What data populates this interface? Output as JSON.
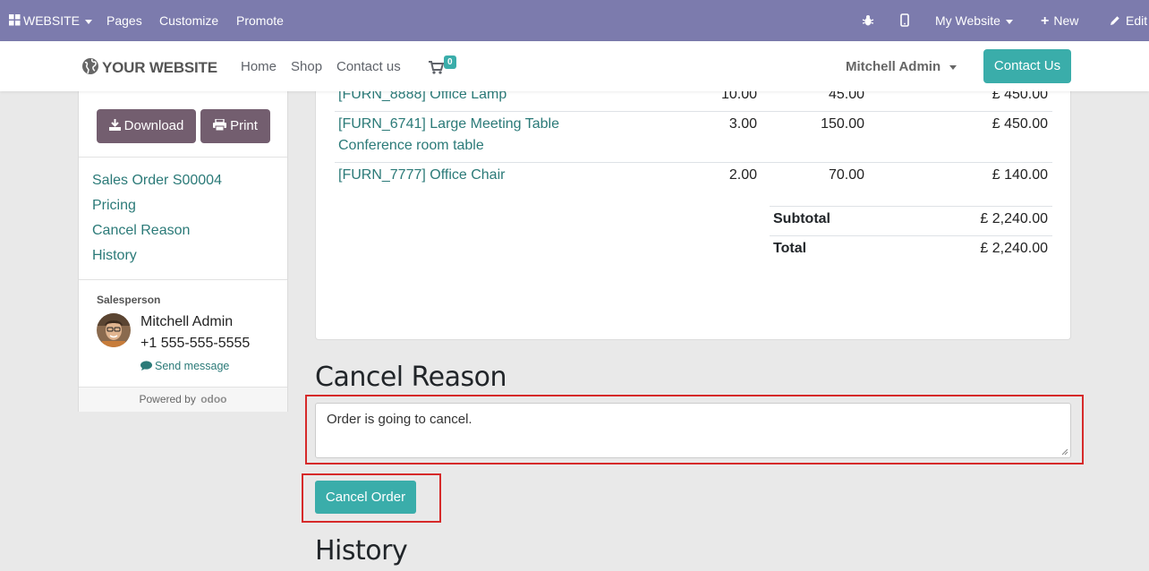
{
  "admin_bar": {
    "website_menu": "WEBSITE",
    "pages": "Pages",
    "customize": "Customize",
    "promote": "Promote",
    "site_selector": "My Website",
    "new": "New",
    "edit": "Edit"
  },
  "site_header": {
    "logo": "YOUR WEBSITE",
    "nav": [
      "Home",
      "Shop",
      "Contact us"
    ],
    "cart_count": "0",
    "user": "Mitchell Admin",
    "contact_button": "Contact Us"
  },
  "sidebar": {
    "download": "Download",
    "print": "Print",
    "links": [
      "Sales Order S00004",
      "Pricing",
      "Cancel Reason",
      "History"
    ],
    "salesperson_label": "Salesperson",
    "salesperson_name": "Mitchell Admin",
    "salesperson_phone": "+1 555-555-5555",
    "send_message": "Send message",
    "powered_by": "Powered by",
    "powered_brand": "odoo"
  },
  "order_lines": [
    {
      "product": "[FURN_8888] Office Lamp",
      "qty": "10.00",
      "price": "45.00",
      "amount": "£ 450.00"
    },
    {
      "product": "[FURN_6741] Large Meeting Table",
      "description": "Conference room table",
      "qty": "3.00",
      "price": "150.00",
      "amount": "£ 450.00"
    },
    {
      "product": "[FURN_7777] Office Chair",
      "qty": "2.00",
      "price": "70.00",
      "amount": "£ 140.00"
    }
  ],
  "totals": {
    "subtotal_label": "Subtotal",
    "subtotal": "£ 2,240.00",
    "total_label": "Total",
    "total": "£ 2,240.00"
  },
  "cancel_section": {
    "heading": "Cancel Reason",
    "reason_value": "Order is going to cancel.",
    "button": "Cancel Order"
  },
  "history_heading": "History",
  "colors": {
    "admin_bar": "#7c7bad",
    "primary": "#3aadaa",
    "secondary_button": "#735e6f",
    "link": "#2b7a78",
    "highlight": "#d62a2a"
  }
}
